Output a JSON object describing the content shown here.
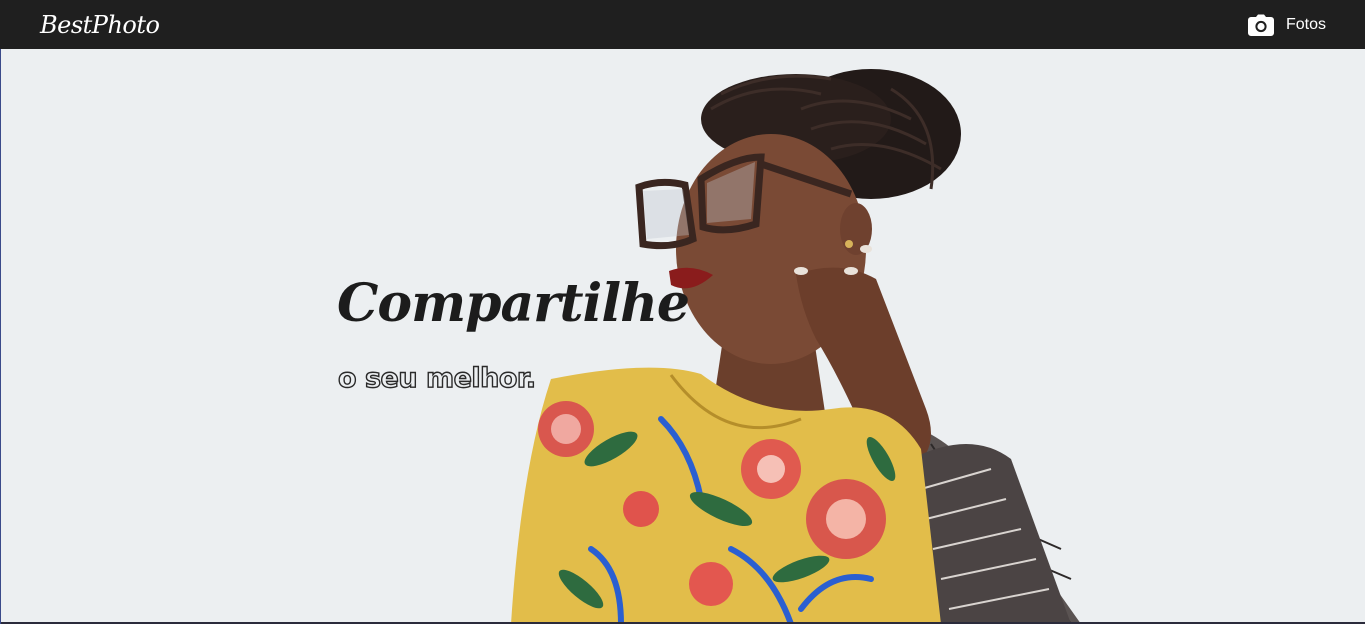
{
  "navbar": {
    "brand": "BestPhoto",
    "link_label": "Fotos",
    "link_icon": "camera-icon"
  },
  "hero": {
    "headline": "Compartilhe",
    "subline": "o seu melhor.",
    "background_color": "#eceff1",
    "image": "woman-with-glasses-portrait"
  },
  "colors": {
    "navbar_bg": "#1f1f1f",
    "headline": "#1c1c1c"
  }
}
